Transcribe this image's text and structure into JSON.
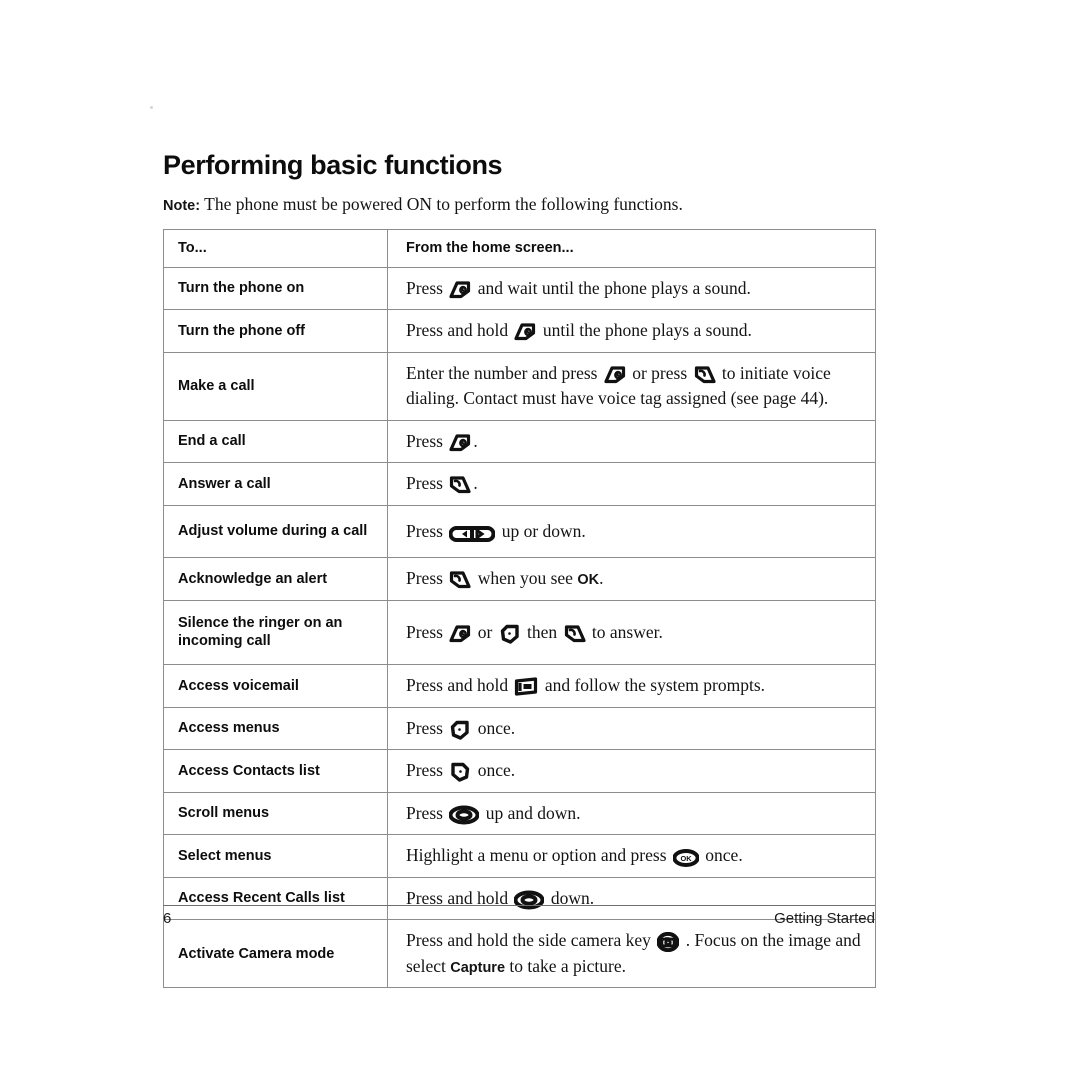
{
  "page": {
    "title": "Performing basic functions",
    "note_label": "Note:",
    "note_text": "The phone must be powered ON to perform the following functions.",
    "footer_page_number": "6",
    "footer_section": "Getting Started"
  },
  "table": {
    "headers": {
      "left": "To...",
      "right": "From the home screen..."
    },
    "rows": [
      {
        "action": "Turn the phone on",
        "parts": [
          {
            "type": "text",
            "value": "Press "
          },
          {
            "type": "icon",
            "icon": "end-power-key-icon"
          },
          {
            "type": "text",
            "value": " and wait until the phone plays a sound."
          }
        ]
      },
      {
        "action": "Turn the phone off",
        "parts": [
          {
            "type": "text",
            "value": "Press and hold "
          },
          {
            "type": "icon",
            "icon": "end-power-key-icon"
          },
          {
            "type": "text",
            "value": " until the phone plays a sound."
          }
        ]
      },
      {
        "action": "Make a call",
        "parts": [
          {
            "type": "text",
            "value": "Enter the number and press "
          },
          {
            "type": "icon",
            "icon": "end-power-key-icon"
          },
          {
            "type": "text",
            "value": " or press "
          },
          {
            "type": "icon",
            "icon": "send-key-icon"
          },
          {
            "type": "text",
            "value": " to initiate voice dialing. Contact must have voice tag assigned (see page 44)."
          }
        ]
      },
      {
        "action": "End a call",
        "parts": [
          {
            "type": "text",
            "value": "Press "
          },
          {
            "type": "icon",
            "icon": "end-power-key-icon"
          },
          {
            "type": "text",
            "value": "."
          }
        ]
      },
      {
        "action": "Answer a call",
        "parts": [
          {
            "type": "text",
            "value": "Press "
          },
          {
            "type": "icon",
            "icon": "send-key-icon"
          },
          {
            "type": "text",
            "value": "."
          }
        ]
      },
      {
        "action": "Adjust volume during a call",
        "parts": [
          {
            "type": "text",
            "value": "Press "
          },
          {
            "type": "icon",
            "icon": "volume-rocker-key-icon"
          },
          {
            "type": "text",
            "value": " up or down."
          }
        ]
      },
      {
        "action": "Acknowledge an alert",
        "parts": [
          {
            "type": "text",
            "value": "Press "
          },
          {
            "type": "icon",
            "icon": "send-key-icon"
          },
          {
            "type": "text",
            "value": " when you see "
          },
          {
            "type": "bold",
            "value": "OK"
          },
          {
            "type": "text",
            "value": "."
          }
        ]
      },
      {
        "action": "Silence the ringer on an incoming call",
        "parts": [
          {
            "type": "text",
            "value": "Press "
          },
          {
            "type": "icon",
            "icon": "end-power-key-icon"
          },
          {
            "type": "text",
            "value": " or "
          },
          {
            "type": "icon",
            "icon": "left-soft-key-icon"
          },
          {
            "type": "text",
            "value": " then "
          },
          {
            "type": "icon",
            "icon": "send-key-icon"
          },
          {
            "type": "text",
            "value": " to answer."
          }
        ]
      },
      {
        "action": "Access voicemail",
        "parts": [
          {
            "type": "text",
            "value": "Press and hold "
          },
          {
            "type": "icon",
            "icon": "voicemail-one-key-icon"
          },
          {
            "type": "text",
            "value": " and follow the system prompts."
          }
        ]
      },
      {
        "action": "Access menus",
        "parts": [
          {
            "type": "text",
            "value": "Press "
          },
          {
            "type": "icon",
            "icon": "left-soft-key-icon"
          },
          {
            "type": "text",
            "value": " once."
          }
        ]
      },
      {
        "action": "Access Contacts list",
        "parts": [
          {
            "type": "text",
            "value": "Press "
          },
          {
            "type": "icon",
            "icon": "right-soft-key-icon"
          },
          {
            "type": "text",
            "value": " once."
          }
        ]
      },
      {
        "action": "Scroll menus",
        "parts": [
          {
            "type": "text",
            "value": "Press "
          },
          {
            "type": "icon",
            "icon": "navigation-key-icon"
          },
          {
            "type": "text",
            "value": " up and down."
          }
        ]
      },
      {
        "action": "Select menus",
        "parts": [
          {
            "type": "text",
            "value": "Highlight a menu or option and press "
          },
          {
            "type": "icon",
            "icon": "ok-key-icon"
          },
          {
            "type": "text",
            "value": " once."
          }
        ]
      },
      {
        "action": "Access Recent Calls list",
        "parts": [
          {
            "type": "text",
            "value": "Press and hold "
          },
          {
            "type": "icon",
            "icon": "navigation-key-icon"
          },
          {
            "type": "text",
            "value": " down."
          }
        ]
      },
      {
        "action": "Activate Camera mode",
        "parts": [
          {
            "type": "text",
            "value": "Press and hold the side camera key "
          },
          {
            "type": "icon",
            "icon": "camera-key-icon"
          },
          {
            "type": "text",
            "value": " . Focus on the image and select "
          },
          {
            "type": "bold",
            "value": "Capture"
          },
          {
            "type": "text",
            "value": " to take a picture."
          }
        ]
      }
    ]
  },
  "colors": {
    "ink": "#141414",
    "rule": "#8d8d8d",
    "heading": "#0d0d0d"
  }
}
